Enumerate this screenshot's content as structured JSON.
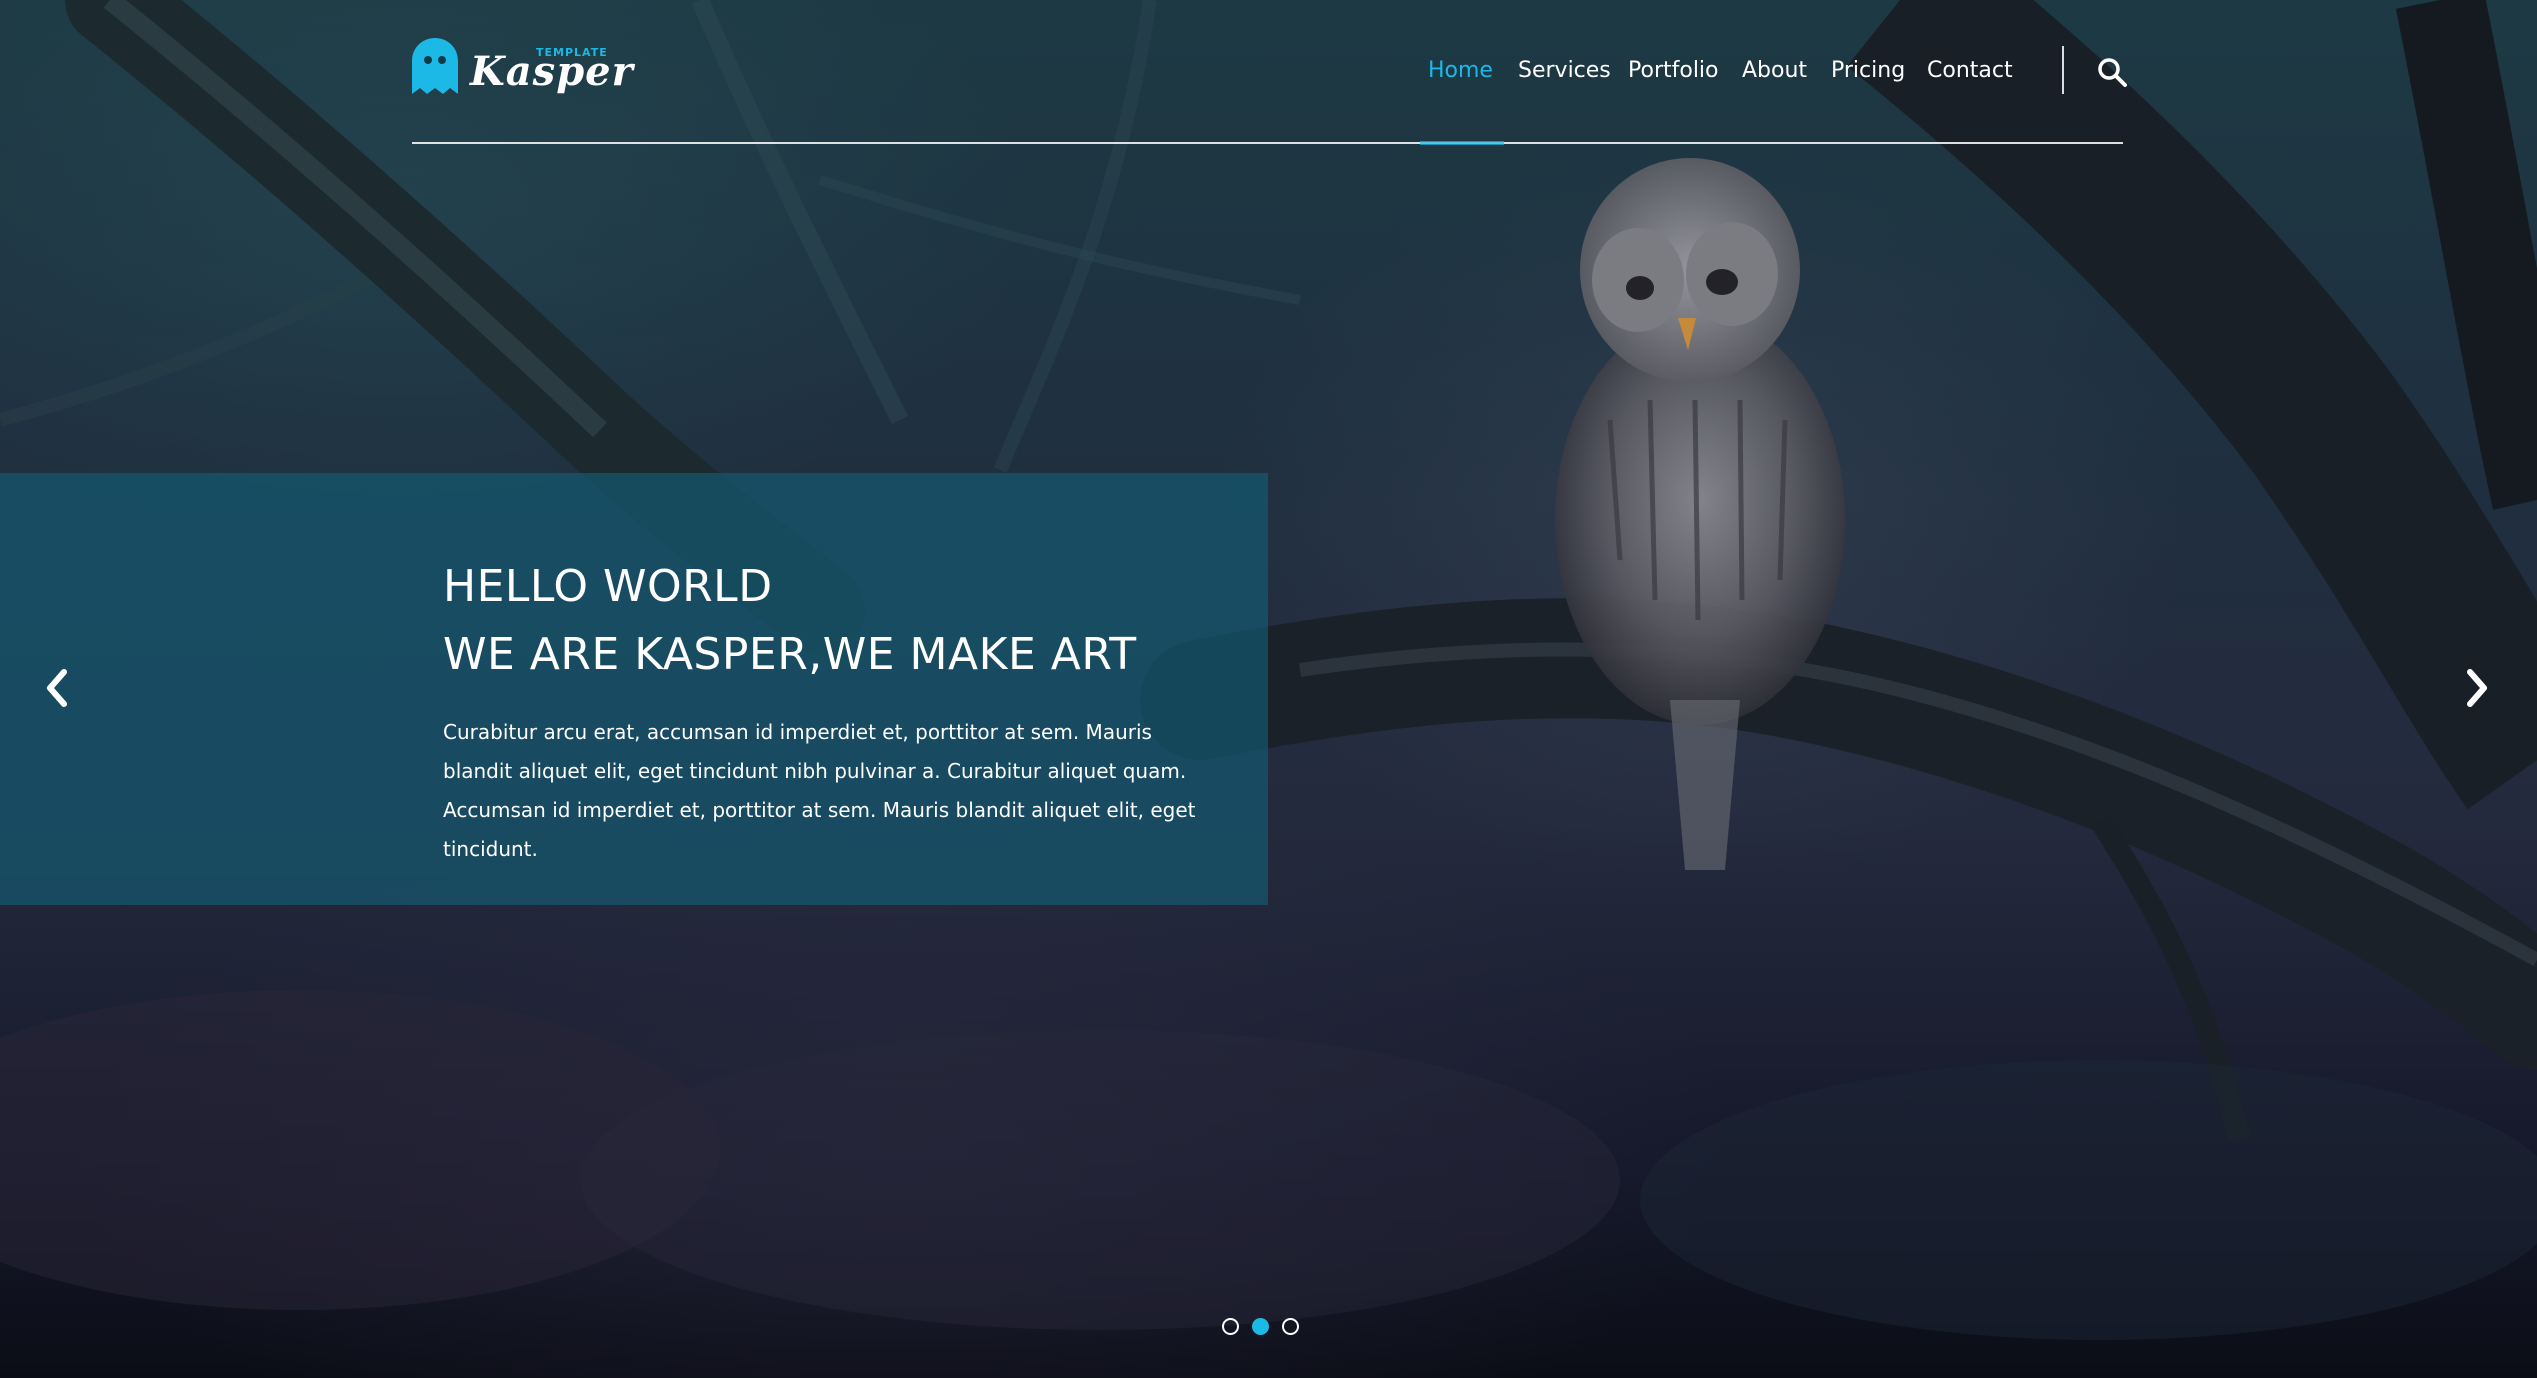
{
  "brand": {
    "name": "Kasper",
    "tagline": "TEMPLATE",
    "accent_color": "#1cb8e6",
    "logo_icon": "ghost-icon"
  },
  "nav": {
    "items": [
      {
        "label": "Home",
        "active": true
      },
      {
        "label": "Services",
        "active": false
      },
      {
        "label": "Portfolio",
        "active": false
      },
      {
        "label": "About",
        "active": false
      },
      {
        "label": "Pricing",
        "active": false
      },
      {
        "label": "Contact",
        "active": false
      }
    ],
    "search_icon": "search-icon"
  },
  "slider": {
    "title_line1": "HELLO WORLD",
    "title_line2": "WE ARE KASPER,WE MAKE ART",
    "text": "Curabitur arcu erat, accumsan id imperdiet et, porttitor at sem. Mauris blandit aliquet elit, eget tincidunt nibh pulvinar a. Curabitur aliquet quam. Accumsan id imperdiet et, porttitor at sem. Mauris blandit aliquet elit, eget tincidunt.",
    "prev_icon": "chevron-left-icon",
    "next_icon": "chevron-right-icon",
    "active_slide": 2,
    "slide_count": 3
  }
}
